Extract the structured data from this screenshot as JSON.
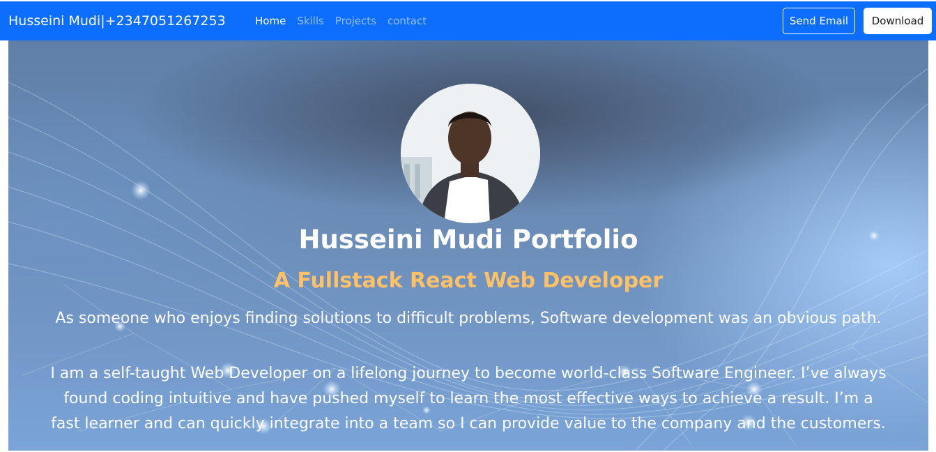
{
  "navbar": {
    "brand": "Husseini Mudi|+2347051267253",
    "links": [
      "Home",
      "Skills",
      "Projects",
      "contact"
    ],
    "send_email_label": "Send Email",
    "download_label": "Download",
    "color": "#0d6efd"
  },
  "hero": {
    "title": "Husseini Mudi Portfolio",
    "subtitle": "A Fullstack React Web Developer",
    "subtitle_color": "#ffc168",
    "lead": "As someone who enjoys finding solutions to difficult problems, Software development was an obvious path.",
    "bio": "I am a self-taught Web Developer on a lifelong journey to become world-class Software Engineer. I’ve always found coding intuitive and have pushed myself to learn the most effective ways to achieve a result. I’m a fast learner and can quickly integrate into a team so I can provide value to the company and the customers."
  }
}
